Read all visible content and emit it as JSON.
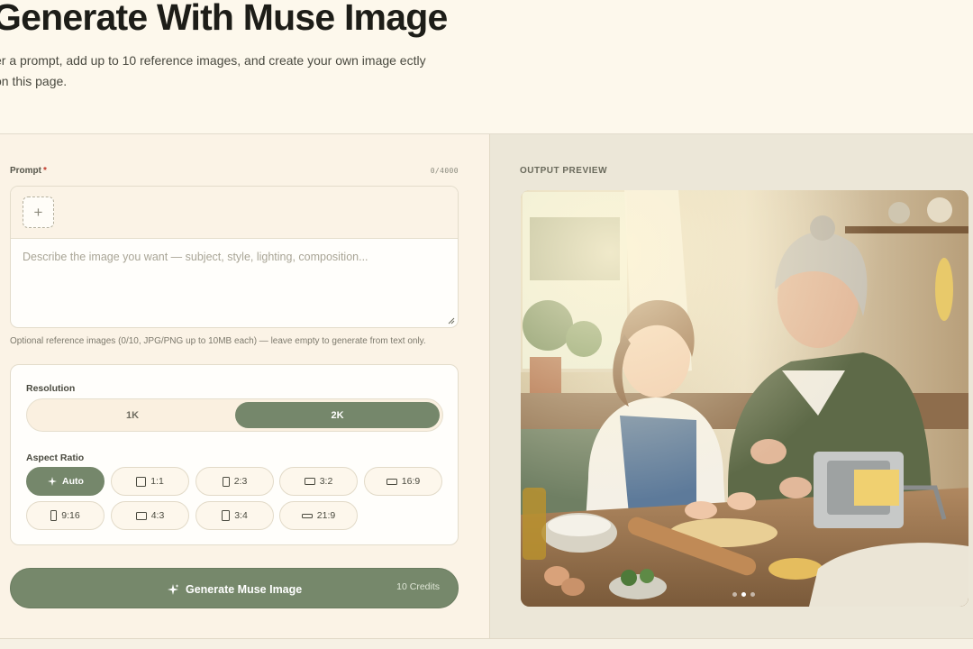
{
  "header": {
    "title": "Generate With Muse Image",
    "subtitle": "er a prompt, add up to 10 reference images, and create your own image ectly on this page."
  },
  "prompt": {
    "label": "Prompt",
    "required_mark": "*",
    "char_count": "0/4000",
    "value": "",
    "placeholder": "Describe the image you want — subject, style, lighting, composition...",
    "add_reference_icon": "plus-icon",
    "helper": "Optional reference images (0/10, JPG/PNG up to 10MB each) — leave empty to generate from text only."
  },
  "resolution": {
    "label": "Resolution",
    "options": [
      "1K",
      "2K"
    ],
    "selected": "2K"
  },
  "aspect_ratio": {
    "label": "Aspect Ratio",
    "options": [
      "Auto",
      "1:1",
      "2:3",
      "3:2",
      "16:9",
      "9:16",
      "4:3",
      "3:4",
      "21:9"
    ],
    "selected": "Auto",
    "auto_icon": "sparkle-icon"
  },
  "generate": {
    "label": "Generate Muse Image",
    "credits": "10 Credits",
    "icon": "sparkle-icon"
  },
  "output": {
    "label": "OUTPUT PREVIEW",
    "image_description": "Grandmother and young girl rolling pasta dough in a sunlit rustic kitchen",
    "carousel_count": 3,
    "carousel_active": 2
  },
  "colors": {
    "accent": "#75876b",
    "background": "#fdf8ec",
    "panel": "#fbf3e6",
    "preview_panel": "#ece7d8"
  }
}
